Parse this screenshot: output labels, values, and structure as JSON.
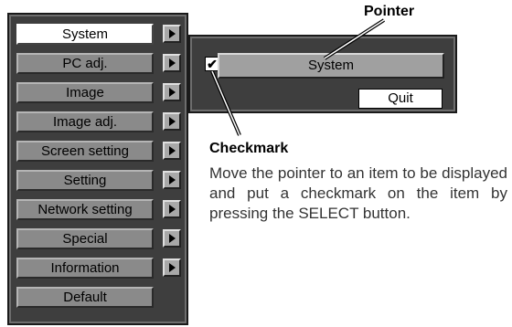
{
  "menu": {
    "items": [
      {
        "label": "System",
        "selected": true,
        "has_arrow": true
      },
      {
        "label": "PC adj.",
        "selected": false,
        "has_arrow": true
      },
      {
        "label": "Image",
        "selected": false,
        "has_arrow": true
      },
      {
        "label": "Image adj.",
        "selected": false,
        "has_arrow": true
      },
      {
        "label": "Screen setting",
        "selected": false,
        "has_arrow": true
      },
      {
        "label": "Setting",
        "selected": false,
        "has_arrow": true
      },
      {
        "label": "Network setting",
        "selected": false,
        "has_arrow": true
      },
      {
        "label": "Special",
        "selected": false,
        "has_arrow": true
      },
      {
        "label": "Information",
        "selected": false,
        "has_arrow": true
      },
      {
        "label": "Default",
        "selected": false,
        "has_arrow": false
      }
    ]
  },
  "submenu": {
    "item_label": "System",
    "checkmark": "✔",
    "quit_label": "Quit"
  },
  "callouts": {
    "pointer_label": "Pointer",
    "checkmark_label": "Checkmark",
    "description": "Move the pointer to an item to be displayed and put a checkmark on the item by pressing the SELECT button."
  },
  "colors": {
    "panel": "#3e3e3e",
    "item": "#8a8a8a",
    "selected_item": "#ffffff"
  }
}
